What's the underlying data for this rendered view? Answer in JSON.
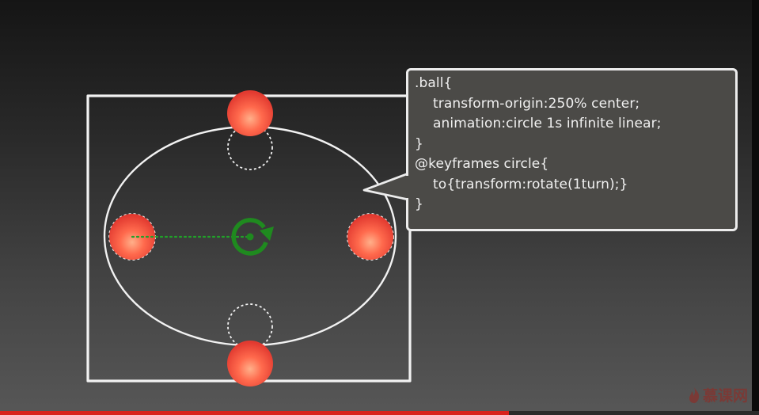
{
  "code": {
    "lines": [
      ".ball{",
      "transform-origin:250% center;",
      "animation:circle 1s infinite linear;",
      "}",
      "@keyframes circle{",
      "to{transform:rotate(1turn);}",
      "}"
    ]
  },
  "watermark": {
    "text": "慕课网",
    "icon": "flame-icon"
  },
  "video_progress": {
    "fraction": 0.67
  },
  "colors": {
    "ball": "#f0503f",
    "ball_highlight": "#ff9a6e",
    "rotate_icon": "#1f8a1f",
    "chalk": "#f2f2f2",
    "progress": "#d9221c"
  }
}
